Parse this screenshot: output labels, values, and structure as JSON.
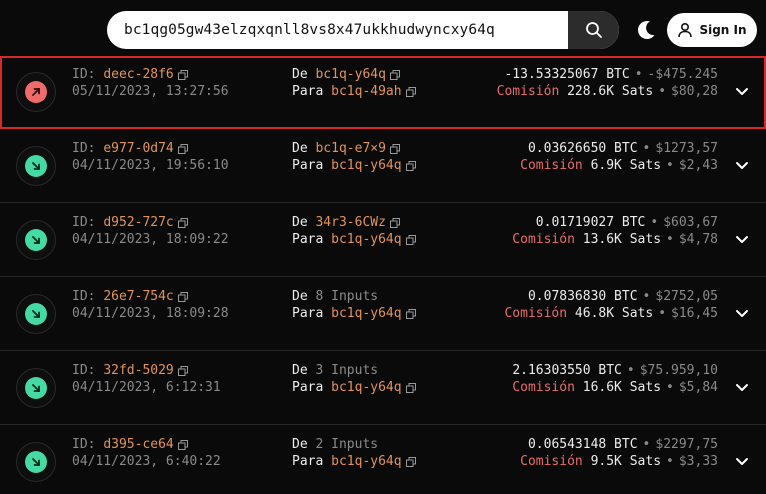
{
  "search": {
    "value": "bc1qg05gw43elzqxqnll8vs8x47ukkhudwyncxy64q"
  },
  "header": {
    "signin_label": "Sign In"
  },
  "labels": {
    "id": "ID:",
    "from": "De",
    "to": "Para",
    "fee": "Comisión",
    "bullet": "•"
  },
  "colors": {
    "outgoing": "#f26b6b",
    "incoming": "#45d9a3",
    "link": "#e29358",
    "fee": "#e86c6c",
    "highlight": "#d62828"
  },
  "transactions": [
    {
      "direction": "out",
      "id": "deec-28f6",
      "datetime": "05/11/2023, 13:27:56",
      "from": "bc1q-y64q",
      "to": "bc1q-49ah",
      "amount_btc": "-13.53325067 BTC",
      "amount_usd": "-$475.245",
      "fee_sats": "228.6K Sats",
      "fee_usd": "$80,28"
    },
    {
      "direction": "in",
      "id": "e977-0d74",
      "datetime": "04/11/2023, 19:56:10",
      "from": "bc1q-e7×9",
      "to": "bc1q-y64q",
      "amount_btc": "0.03626650 BTC",
      "amount_usd": "$1273,57",
      "fee_sats": "6.9K Sats",
      "fee_usd": "$2,43"
    },
    {
      "direction": "in",
      "id": "d952-727c",
      "datetime": "04/11/2023, 18:09:22",
      "from": "34r3-6CWz",
      "to": "bc1q-y64q",
      "amount_btc": "0.01719027 BTC",
      "amount_usd": "$603,67",
      "fee_sats": "13.6K Sats",
      "fee_usd": "$4,78"
    },
    {
      "direction": "in",
      "id": "26e7-754c",
      "datetime": "04/11/2023, 18:09:28",
      "from": "8 Inputs",
      "to": "bc1q-y64q",
      "amount_btc": "0.07836830 BTC",
      "amount_usd": "$2752,05",
      "fee_sats": "46.8K Sats",
      "fee_usd": "$16,45"
    },
    {
      "direction": "in",
      "id": "32fd-5029",
      "datetime": "04/11/2023, 6:12:31",
      "from": "3 Inputs",
      "to": "bc1q-y64q",
      "amount_btc": "2.16303550 BTC",
      "amount_usd": "$75.959,10",
      "fee_sats": "16.6K Sats",
      "fee_usd": "$5,84"
    },
    {
      "direction": "in",
      "id": "d395-ce64",
      "datetime": "04/11/2023, 6:40:22",
      "from": "2 Inputs",
      "to": "bc1q-y64q",
      "amount_btc": "0.06543148 BTC",
      "amount_usd": "$2297,75",
      "fee_sats": "9.5K Sats",
      "fee_usd": "$3,33"
    }
  ]
}
